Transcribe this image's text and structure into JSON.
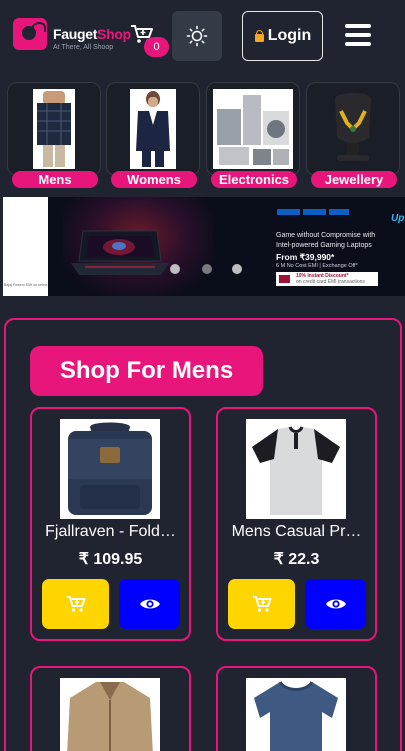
{
  "header": {
    "logo_name_a": "Fauget",
    "logo_name_b": "Shop",
    "logo_tagline": "At There, All Shoop",
    "cart_count": "0",
    "login_label": "Login"
  },
  "categories": [
    {
      "label": "Mens",
      "icon": "shirt-photo"
    },
    {
      "label": "Womens",
      "icon": "blazer-photo"
    },
    {
      "label": "Electronics",
      "icon": "appliances-photo"
    },
    {
      "label": "Jewellery",
      "icon": "necklace-photo"
    }
  ],
  "banner": {
    "left_note": "Bajaj Finserv EMI on select",
    "headline_1": "Game without Compromise with",
    "headline_2": "Intel-powered Gaming Laptops",
    "price": "From ₹39,990*",
    "emi": "6 M No Cost EMI | Exchange Off*",
    "bank_line_1": "10% Instant Discount*",
    "bank_line_2": "on credit card EMI transactions",
    "brand_tag": "Up",
    "active_slide": 1,
    "slide_count": 3
  },
  "shop": {
    "title": "Shop For Mens",
    "products": [
      {
        "name": "Fjallraven - Fold…",
        "price": "₹ 109.95",
        "image": "backpack-photo"
      },
      {
        "name": "Mens Casual Pr…",
        "price": "₹ 22.3",
        "image": "henley-tshirt-photo"
      },
      {
        "name": "",
        "price": "",
        "image": "jacket-photo"
      },
      {
        "name": "",
        "price": "",
        "image": "slimfit-tshirt-photo"
      }
    ]
  },
  "colors": {
    "background": "#1f2430",
    "accent": "#e8157b",
    "cart_button": "#ffd500",
    "view_button": "#0000ff"
  }
}
